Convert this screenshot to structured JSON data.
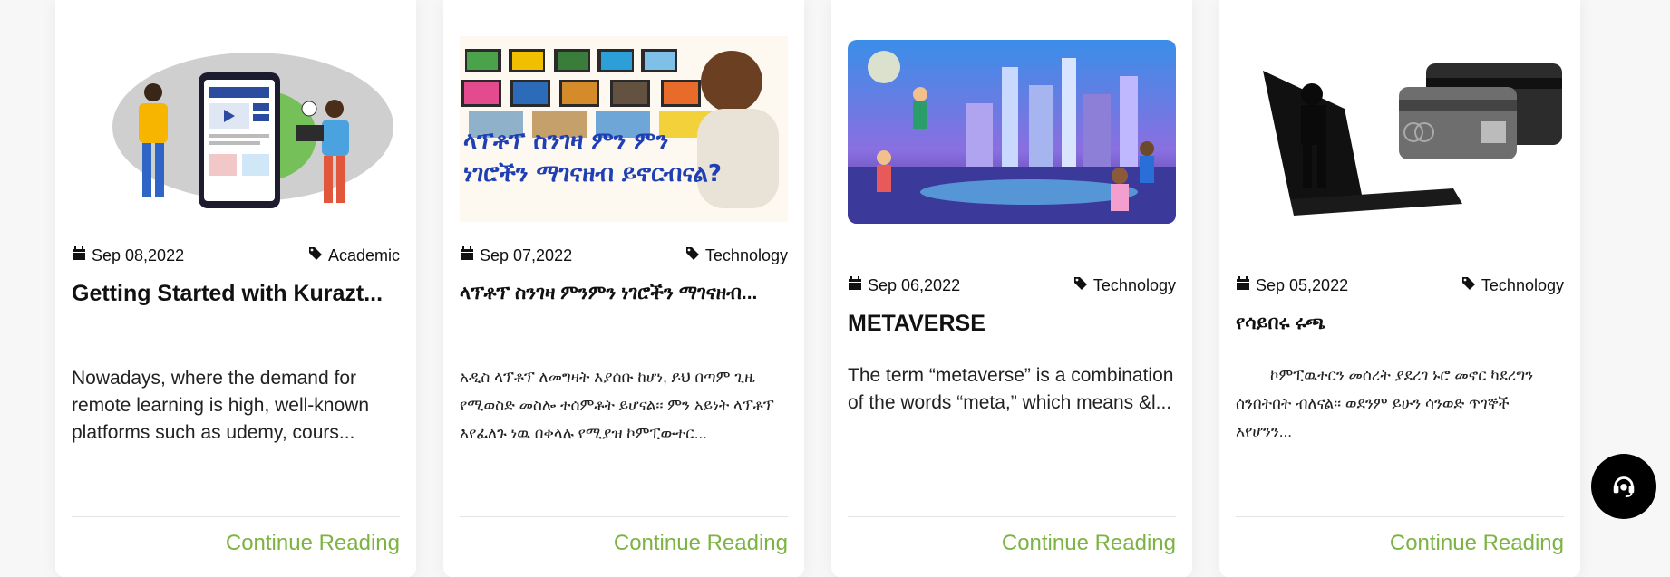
{
  "cards": [
    {
      "date": "Sep 08,2022",
      "category": "Academic",
      "title": "Getting Started with Kurazt...",
      "excerpt": "Nowadays, where the demand for remote learning is high, well-known platforms such as udemy, cours...",
      "cta": "Continue Reading",
      "image_icon": "remote-learning-illustration"
    },
    {
      "date": "Sep 07,2022",
      "category": "Technology",
      "title": "ላፕቶፕ ስንገዛ ምንምን ነገሮችን ማገናዘብ...",
      "excerpt": "አዲስ ላፕቶፕ ለመግዛት እያሰቡ ከሆነ, ይህ በጣም ጊዜ የሚወስድ መስሎ ተሰምቶት ይሆናል፡፡ ምን አይነት ላፕቶፕ እየፈለጉ ነዉ በቀላሉ የሚያዝ ኮምፒውተር...",
      "cta": "Continue Reading",
      "image_text": "ላፕቶፕ ስንገዛ ምን ምን ነገሮችን ማገናዘብ ይኖርብናል?",
      "image_icon": "laptops-collage"
    },
    {
      "date": "Sep 06,2022",
      "category": "Technology",
      "title": "METAVERSE",
      "excerpt": "The term “metaverse” is a combination of the words “meta,” which means &l...",
      "cta": "Continue Reading",
      "image_icon": "metaverse-city-scene"
    },
    {
      "date": "Sep 05,2022",
      "category": "Technology",
      "title": "የሳይበሩ ሩጫ",
      "excerpt": "ኮምፒዉተርን መሰረት ያደረገ ኑሮ መኖር ካደረግን ሰንበትበት ብለናል፡፡ ወደንም ይሁን ሳንወድ ጥገኞች እየሆንን...",
      "cta": "Continue Reading",
      "image_icon": "cyber-thief-laptop-cards"
    }
  ],
  "support_button_icon": "headset-icon",
  "colors": {
    "accent": "#7cb342",
    "text": "#111111",
    "background": "#f7f7f7"
  }
}
